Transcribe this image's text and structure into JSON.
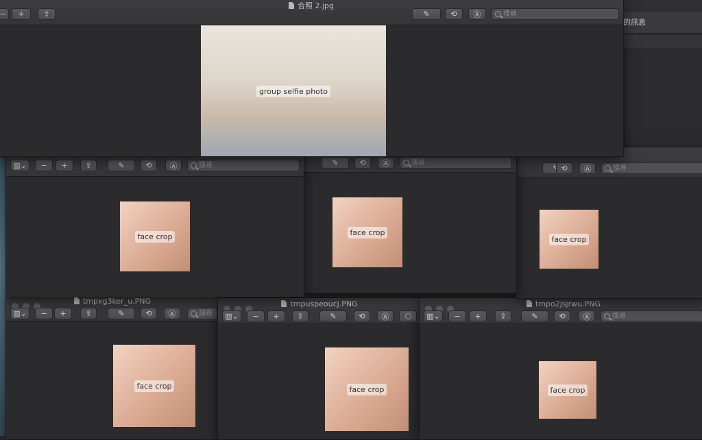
{
  "main_window": {
    "title": "合照 2.jpg",
    "search_placeholder": "搜尋",
    "image_label": "group selfie photo"
  },
  "side_panel": {
    "header": "的訊息"
  },
  "middle_row": [
    {
      "search_placeholder": "搜尋",
      "image_label": "face crop"
    },
    {
      "search_placeholder": "搜尋",
      "image_label": "face crop"
    },
    {
      "search_placeholder": "搜尋",
      "image_label": "face crop"
    }
  ],
  "bottom_row": [
    {
      "title": "tmpxg3ker_u.PNG",
      "search_placeholder": "搜尋",
      "image_label": "face crop"
    },
    {
      "title": "tmpuspeoucj.PNG",
      "search_placeholder": "",
      "image_label": "face crop"
    },
    {
      "title": "tmpo2jsjrwu.PNG",
      "search_placeholder": "搜尋",
      "image_label": "face crop"
    }
  ],
  "icons": {
    "zoom_out": "−",
    "zoom_in": "+",
    "share": "⇪",
    "markup": "Ⓐ",
    "pen": "✎",
    "rotate": "⟲",
    "sidebar": "▥",
    "chevron": "⌄"
  }
}
